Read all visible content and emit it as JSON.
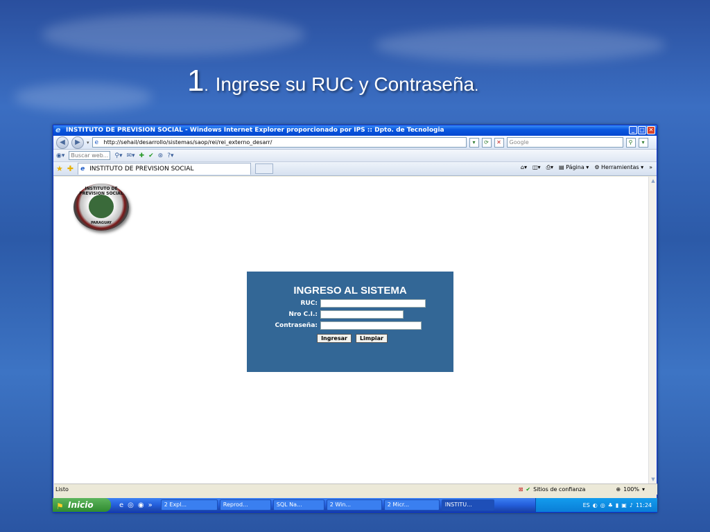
{
  "slide": {
    "title_number": "1",
    "title_dot": ".",
    "title_text": "Ingrese su RUC y Contraseña",
    "title_end_dot": "."
  },
  "browser": {
    "window_title": "INSTITUTO DE PREVISION SOCIAL - Windows Internet Explorer proporcionado por IPS :: Dpto. de Tecnologia",
    "address": "http://sehail/desarrollo/sistemas/saop/rei/rei_externo_desarr/",
    "search_placeholder": "Google",
    "toolbar_search_placeholder": "Buscar web...",
    "tab_title": "INSTITUTO DE PREVISION SOCIAL",
    "cmd_page": "Página",
    "cmd_tools": "Herramientas",
    "status_text": "Listo",
    "zone_text": "Sitios de confianza",
    "zoom": "100%"
  },
  "logo": {
    "top_text": "INSTITUTO DE PREVISION SOCIAL",
    "bottom_text": "PARAGUAY"
  },
  "login": {
    "title": "INGRESO AL SISTEMA",
    "ruc_label": "RUC:",
    "ci_label": "Nro C.I.:",
    "password_label": "Contraseña:",
    "submit_label": "Ingresar",
    "clear_label": "Limpiar"
  },
  "taskbar": {
    "start_label": "Inicio",
    "items": [
      "2 Expl...",
      "Reprod...",
      "SQL Na...",
      "2 Win...",
      "2 Micr...",
      "INSTITU..."
    ],
    "lang": "ES",
    "clock": "11:24"
  }
}
